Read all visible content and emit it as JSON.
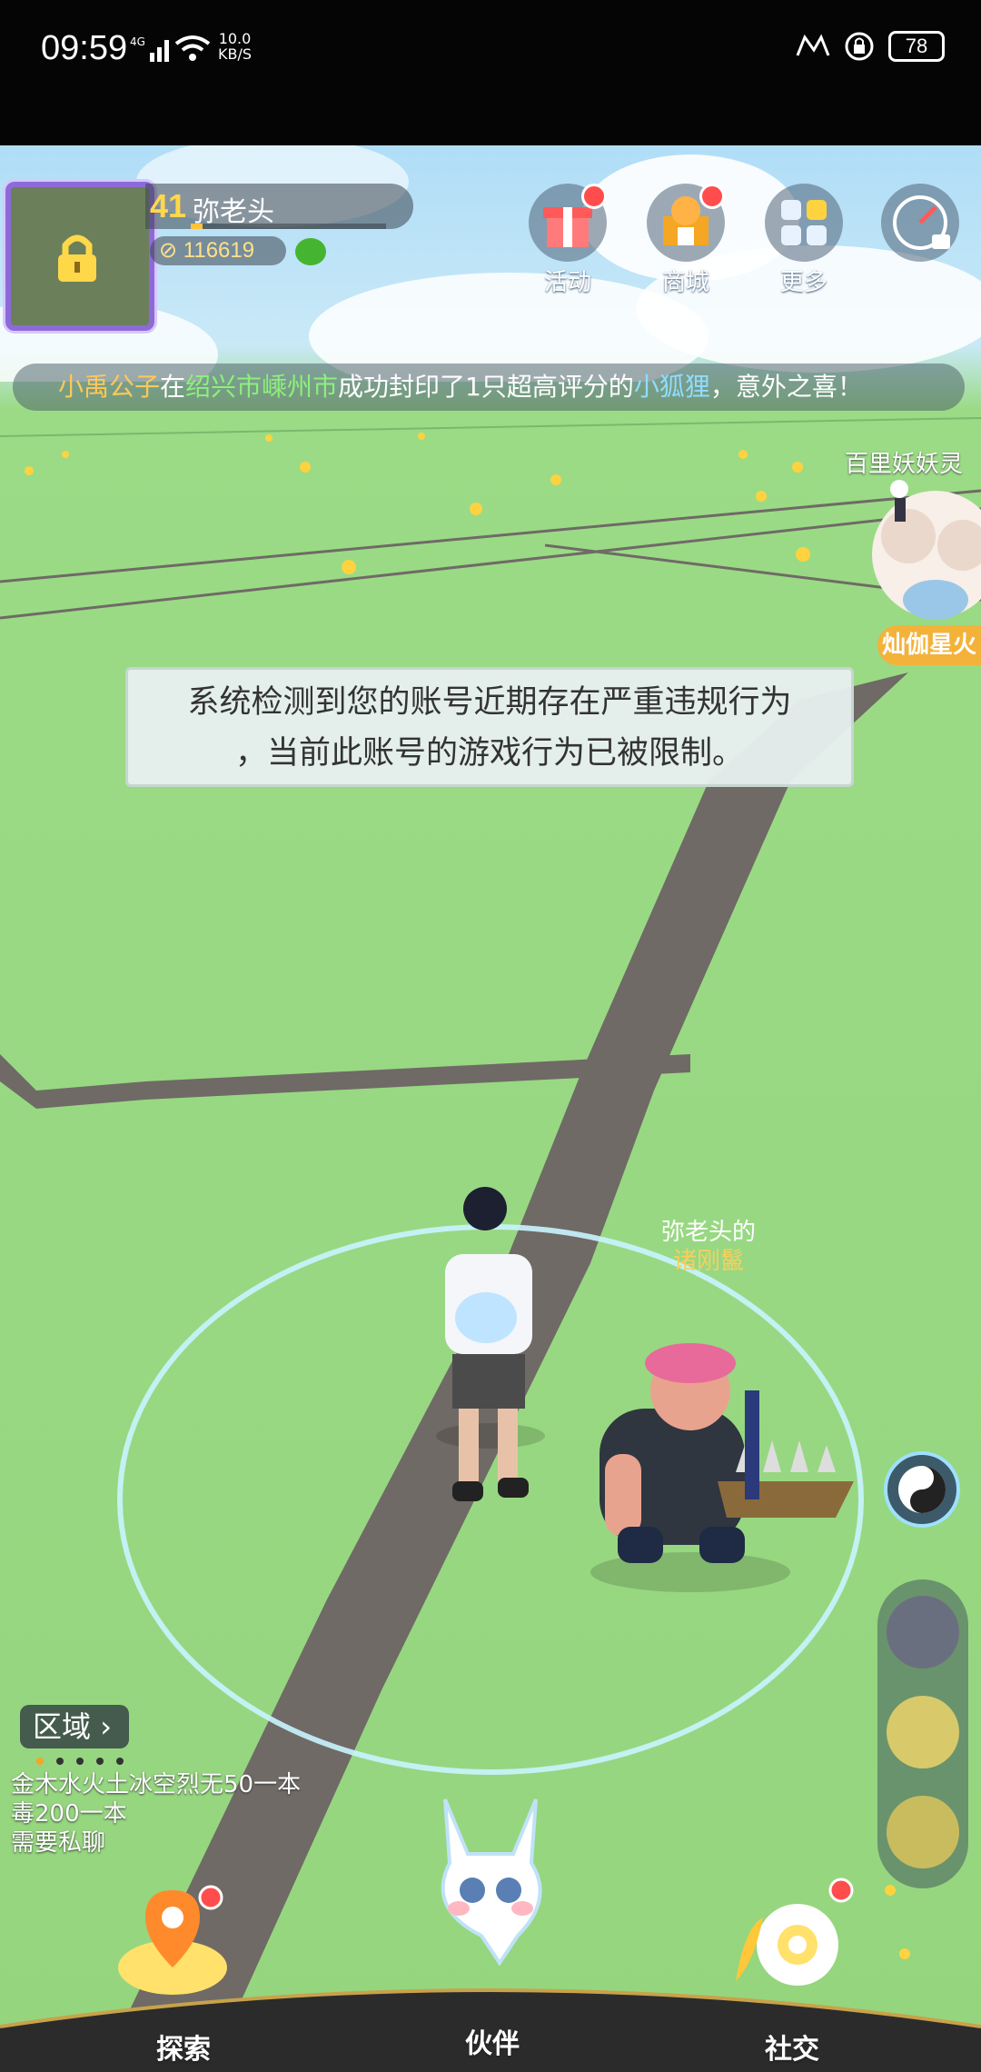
{
  "status": {
    "time": "09:59",
    "signal": "4G",
    "net_speed_value": "10.0",
    "net_speed_unit": "KB/S",
    "battery": "78"
  },
  "player": {
    "level": "41",
    "name": "弥老头",
    "coins": "116619",
    "exp_fraction": 0.06
  },
  "top_buttons": [
    {
      "label": "活动",
      "icon": "gift-icon",
      "badge": true
    },
    {
      "label": "商城",
      "icon": "shop-icon",
      "badge": true
    },
    {
      "label": "更多",
      "icon": "more-grid-icon",
      "badge": false
    },
    {
      "label": "",
      "icon": "compass-locked-icon",
      "badge": false
    }
  ],
  "news": {
    "user": "小禹公子",
    "t1": "在",
    "place": "绍兴市嵊州市",
    "t2": "成功封印了1只超高评分的",
    "pet": "小狐狸",
    "t3": "，意外之喜！"
  },
  "npc": {
    "name": "百里妖妖灵",
    "tag": "灿伽星火"
  },
  "notice": {
    "line1": "系统检测到您的账号近期存在严重违规行为",
    "line2": "，当前此账号的游戏行为已被限制。"
  },
  "pet_owner": {
    "owner": "弥老头的",
    "species": "诸刚鬣"
  },
  "region": {
    "label": "区域",
    "page_index": 0,
    "page_count": 5
  },
  "chat": {
    "lines": [
      "金木水火土冰空烈无50一本",
      "毒200一本",
      "需要私聊"
    ]
  },
  "bottom_nav": {
    "explore": "探索",
    "partner": "伙伴",
    "social": "社交"
  },
  "colors": {
    "grass": "#95d57e",
    "road": "#6f6a66",
    "accent_orange": "#ffc857",
    "badge_red": "#ff4d4d"
  }
}
